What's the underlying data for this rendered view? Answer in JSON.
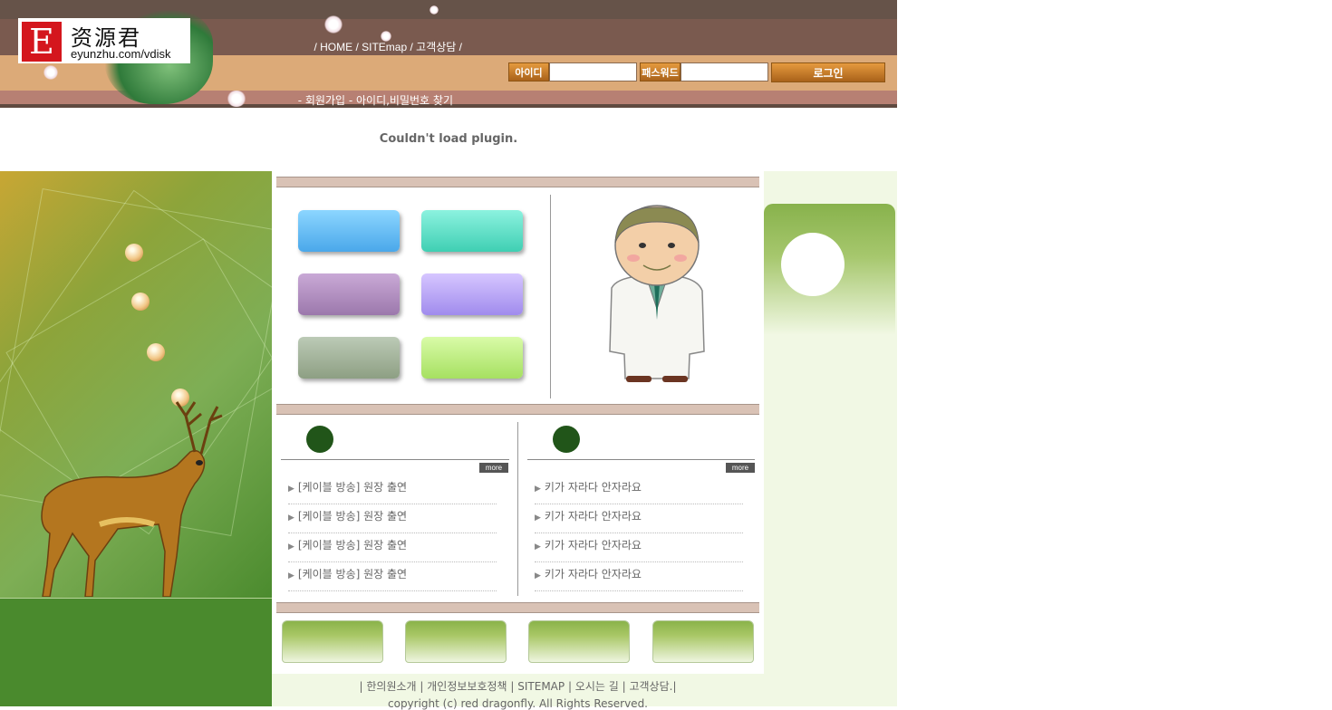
{
  "header": {
    "logo": {
      "letter": "E",
      "chinese": "资源君",
      "url": "eyunzhu.com/vdisk"
    },
    "topnav": [
      "HOME",
      "SITEmap",
      "고객상담"
    ],
    "login": {
      "id_label": "아이디",
      "pw_label": "패스워드",
      "button": "로그인",
      "id_value": "",
      "pw_value": ""
    },
    "sublinks": [
      "회원가입",
      "아이디,비밀번호 찾기"
    ]
  },
  "plugin_message": "Couldn't load plugin.",
  "middle": {
    "button_colors": [
      "#5cbcf3",
      "#4fe3cb",
      "#b08ac0",
      "#b49cf5",
      "#9fb396",
      "#bdf27d"
    ],
    "news_left": {
      "more": "more",
      "items": [
        "[케이블 방송] 원장 출연",
        "[케이블 방송] 원장 출연",
        "[케이블 방송] 원장 출연",
        "[케이블 방송] 원장 출연"
      ]
    },
    "news_right": {
      "more": "more",
      "items": [
        "키가 자라다 안자라요",
        "키가 자라다 안자라요",
        "키가 자라다 안자라요",
        "키가 자라다 안자라요"
      ]
    }
  },
  "footer": {
    "links": [
      "한의원소개",
      "개인정보보호정책",
      "SITEMAP",
      "오시는 길",
      "고객상담."
    ],
    "copyright": "copyright (c) red dragonfly. All Rights Reserved."
  }
}
